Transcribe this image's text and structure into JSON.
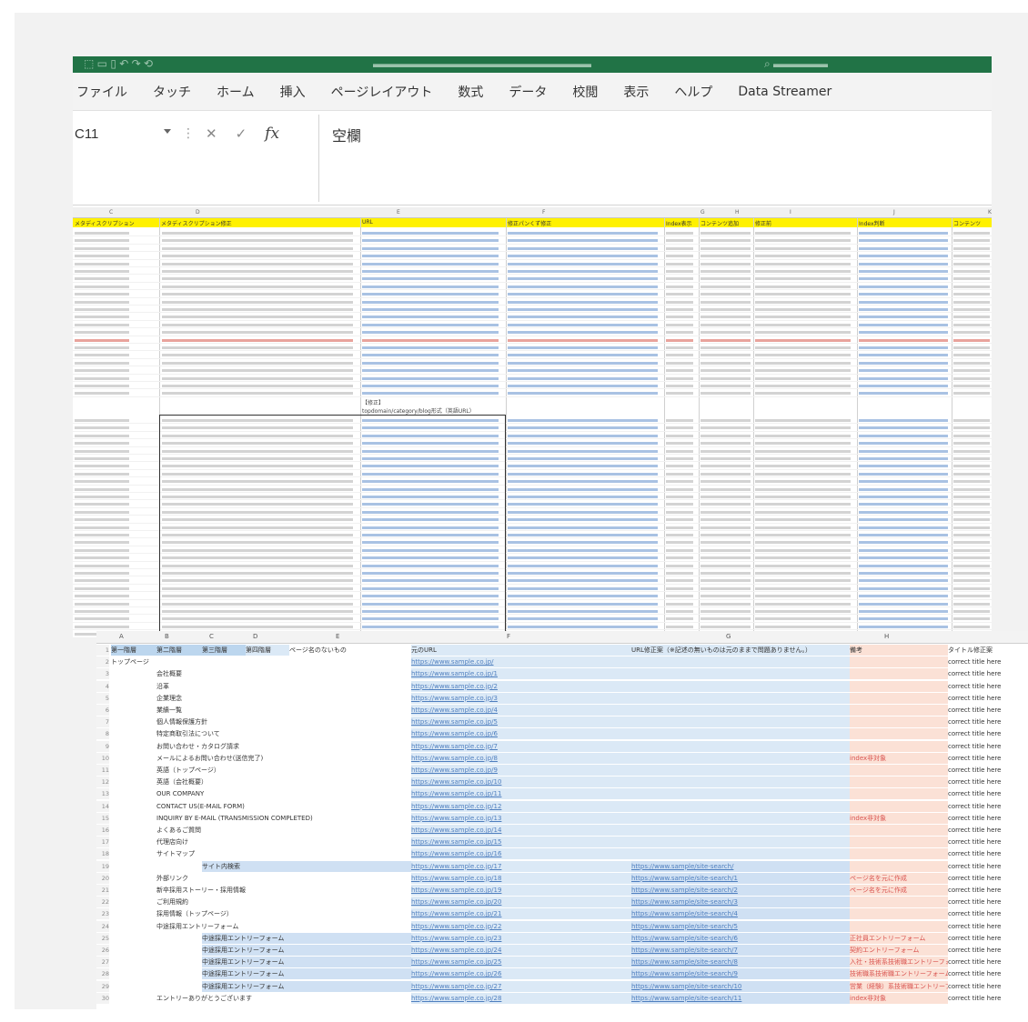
{
  "excel": {
    "ribbon_tabs": [
      "ファイル",
      "タッチ",
      "ホーム",
      "挿入",
      "ページレイアウト",
      "数式",
      "データ",
      "校閲",
      "表示",
      "ヘルプ",
      "Data Streamer"
    ],
    "name_box": "C11",
    "formula_value": "空欄",
    "icons": [
      "cancel-icon",
      "enter-icon",
      "function-icon"
    ]
  },
  "top_sheet": {
    "column_letters": [
      "C",
      "D",
      "E",
      "F",
      "G",
      "H",
      "I",
      "J",
      "K"
    ],
    "header_row": [
      "メタディスクリプション",
      "メタディスクリプション修正",
      "URL",
      "修正パンくず修正",
      "Index表示",
      "コンテンツ追加",
      "修正前",
      "Index判断",
      "コンテンツ"
    ],
    "note_label": "【修正】",
    "note_path": "topdomain/category/blog形式（英語URL）"
  },
  "bottom_sheet": {
    "columns": [
      "A",
      "B",
      "C",
      "D",
      "E",
      "F",
      "G",
      "H"
    ],
    "header": {
      "a": "第一階層",
      "b": "第二階層",
      "c": "第三階層",
      "d": "第四階層",
      "e": "ページ名のないもの",
      "f": "元のURL",
      "g": "URL修正案（※記述の無いものは元のままで問題ありません。）",
      "h": "備考",
      "i": "タイトル修正案"
    },
    "rows": [
      {
        "n": "2",
        "label": "トップページ",
        "indent": 0,
        "url": "https://www.sample.co.jp/",
        "new_url": "",
        "note": "",
        "title": "correct title here"
      },
      {
        "n": "3",
        "label": "会社概要",
        "indent": 1,
        "url": "https://www.sample.co.jp/1",
        "new_url": "",
        "note": "",
        "title": "correct title here"
      },
      {
        "n": "4",
        "label": "沿革",
        "indent": 1,
        "url": "https://www.sample.co.jp/2",
        "new_url": "",
        "note": "",
        "title": "correct title here"
      },
      {
        "n": "5",
        "label": "企業理念",
        "indent": 1,
        "url": "https://www.sample.co.jp/3",
        "new_url": "",
        "note": "",
        "title": "correct title here"
      },
      {
        "n": "6",
        "label": "業績一覧",
        "indent": 1,
        "url": "https://www.sample.co.jp/4",
        "new_url": "",
        "note": "",
        "title": "correct title here"
      },
      {
        "n": "7",
        "label": "個人情報保護方針",
        "indent": 1,
        "url": "https://www.sample.co.jp/5",
        "new_url": "",
        "note": "",
        "title": "correct title here"
      },
      {
        "n": "8",
        "label": "特定商取引法について",
        "indent": 1,
        "url": "https://www.sample.co.jp/6",
        "new_url": "",
        "note": "",
        "title": "correct title here"
      },
      {
        "n": "9",
        "label": "お問い合わせ・カタログ請求",
        "indent": 1,
        "url": "https://www.sample.co.jp/7",
        "new_url": "",
        "note": "",
        "title": "correct title here"
      },
      {
        "n": "10",
        "label": "メールによるお問い合わせ(送信完了)",
        "indent": 1,
        "url": "https://www.sample.co.jp/8",
        "new_url": "",
        "note": "index非対象",
        "title": "correct title here"
      },
      {
        "n": "11",
        "label": "英語（トップページ）",
        "indent": 1,
        "url": "https://www.sample.co.jp/9",
        "new_url": "",
        "note": "",
        "title": "correct title here"
      },
      {
        "n": "12",
        "label": "英語（会社概要）",
        "indent": 1,
        "url": "https://www.sample.co.jp/10",
        "new_url": "",
        "note": "",
        "title": "correct title here"
      },
      {
        "n": "13",
        "label": "OUR COMPANY",
        "indent": 1,
        "url": "https://www.sample.co.jp/11",
        "new_url": "",
        "note": "",
        "title": "correct title here"
      },
      {
        "n": "14",
        "label": "CONTACT US(E-MAIL FORM)",
        "indent": 1,
        "url": "https://www.sample.co.jp/12",
        "new_url": "",
        "note": "",
        "title": "correct title here"
      },
      {
        "n": "15",
        "label": "INQUIRY BY E-MAIL (TRANSMISSION COMPLETED)",
        "indent": 1,
        "url": "https://www.sample.co.jp/13",
        "new_url": "",
        "note": "index非対象",
        "title": "correct title here"
      },
      {
        "n": "16",
        "label": "よくあるご質問",
        "indent": 1,
        "url": "https://www.sample.co.jp/14",
        "new_url": "",
        "note": "",
        "title": "correct title here"
      },
      {
        "n": "17",
        "label": "代理店向け",
        "indent": 1,
        "url": "https://www.sample.co.jp/15",
        "new_url": "",
        "note": "",
        "title": "correct title here"
      },
      {
        "n": "18",
        "label": "サイトマップ",
        "indent": 1,
        "url": "https://www.sample.co.jp/16",
        "new_url": "",
        "note": "",
        "title": "correct title here"
      },
      {
        "n": "19",
        "label": "サイト内検索",
        "indent": 2,
        "url": "https://www.sample.co.jp/17",
        "new_url": "https://www.sample/site-search/",
        "note": "",
        "title": "correct title here"
      },
      {
        "n": "20",
        "label": "外部リンク",
        "indent": 1,
        "url": "https://www.sample.co.jp/18",
        "new_url": "https://www.sample/site-search/1",
        "note": "ページ名を元に作成",
        "title": "correct title here"
      },
      {
        "n": "21",
        "label": "新卒採用ストーリー・採用情報",
        "indent": 1,
        "url": "https://www.sample.co.jp/19",
        "new_url": "https://www.sample/site-search/2",
        "note": "ページ名を元に作成",
        "title": "correct title here"
      },
      {
        "n": "22",
        "label": "ご利用規約",
        "indent": 1,
        "url": "https://www.sample.co.jp/20",
        "new_url": "https://www.sample/site-search/3",
        "note": "",
        "title": "correct title here"
      },
      {
        "n": "23",
        "label": "採用情報（トップページ）",
        "indent": 1,
        "url": "https://www.sample.co.jp/21",
        "new_url": "https://www.sample/site-search/4",
        "note": "",
        "title": "correct title here"
      },
      {
        "n": "24",
        "label": "中途採用エントリーフォーム",
        "indent": 1,
        "url": "https://www.sample.co.jp/22",
        "new_url": "https://www.sample/site-search/5",
        "note": "",
        "title": "correct title here"
      },
      {
        "n": "25",
        "label": "中途採用エントリーフォーム",
        "indent": 2,
        "url": "https://www.sample.co.jp/23",
        "new_url": "https://www.sample/site-search/6",
        "note": "正社員エントリーフォーム",
        "title": "correct title here"
      },
      {
        "n": "26",
        "label": "中途採用エントリーフォーム",
        "indent": 2,
        "url": "https://www.sample.co.jp/24",
        "new_url": "https://www.sample/site-search/7",
        "note": "契約エントリーフォーム",
        "title": "correct title here"
      },
      {
        "n": "27",
        "label": "中途採用エントリーフォーム",
        "indent": 2,
        "url": "https://www.sample.co.jp/25",
        "new_url": "https://www.sample/site-search/8",
        "note": "入社・技術系技術職エントリーフォーム",
        "title": "correct title here"
      },
      {
        "n": "28",
        "label": "中途採用エントリーフォーム",
        "indent": 2,
        "url": "https://www.sample.co.jp/26",
        "new_url": "https://www.sample/site-search/9",
        "note": "技術職系技術職エントリーフォーム",
        "title": "correct title here"
      },
      {
        "n": "29",
        "label": "中途採用エントリーフォーム",
        "indent": 2,
        "url": "https://www.sample.co.jp/27",
        "new_url": "https://www.sample/site-search/10",
        "note": "営業（経験）系技術職エントリーフォーム",
        "title": "correct title here"
      },
      {
        "n": "30",
        "label": "エントリーありがとうございます",
        "indent": 1,
        "url": "https://www.sample.co.jp/28",
        "new_url": "https://www.sample/site-search/11",
        "note": "index非対象",
        "title": "correct title here"
      }
    ]
  },
  "colors": {
    "excel_green": "#217346",
    "header_yellow": "#fff100",
    "link_blue": "#4f7fbf",
    "cell_blue": "#dbe9f6",
    "cell_pink": "#fbe1d6"
  }
}
